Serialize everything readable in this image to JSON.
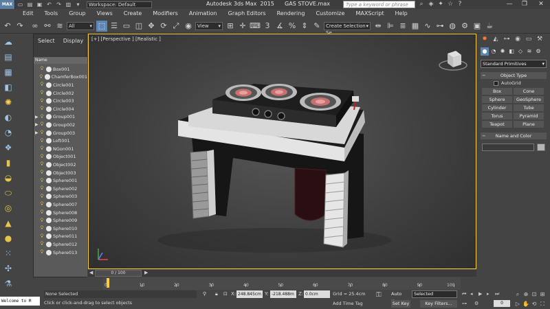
{
  "title_bar": {
    "logo": "MAX",
    "workspace": "Workspace: Default",
    "title": "Autodesk 3ds Max  2015      GAS STOVE.max",
    "search_placeholder": "Type a keyword or phrase"
  },
  "menu": [
    "Edit",
    "Tools",
    "Group",
    "Views",
    "Create",
    "Modifiers",
    "Animation",
    "Graph Editors",
    "Rendering",
    "Customize",
    "MAXScript",
    "Help"
  ],
  "toolbar": {
    "filter": "All",
    "ref_coord": "View",
    "named_sel": "Create Selection Se"
  },
  "explorer": {
    "tabs": [
      "Select",
      "Display"
    ],
    "header": "Name",
    "items": [
      {
        "name": "Box001",
        "group": false
      },
      {
        "name": "ChamferBox001",
        "group": false
      },
      {
        "name": "Circle001",
        "group": false
      },
      {
        "name": "Circle002",
        "group": false
      },
      {
        "name": "Circle003",
        "group": false
      },
      {
        "name": "Circle004",
        "group": false
      },
      {
        "name": "Group001",
        "group": true
      },
      {
        "name": "Group002",
        "group": true
      },
      {
        "name": "Group003",
        "group": true
      },
      {
        "name": "Loft001",
        "group": false
      },
      {
        "name": "NGon001",
        "group": false
      },
      {
        "name": "Object001",
        "group": false
      },
      {
        "name": "Object002",
        "group": false
      },
      {
        "name": "Object003",
        "group": false
      },
      {
        "name": "Sphere001",
        "group": false
      },
      {
        "name": "Sphere002",
        "group": false
      },
      {
        "name": "Sphere003",
        "group": false
      },
      {
        "name": "Sphere007",
        "group": false
      },
      {
        "name": "Sphere008",
        "group": false
      },
      {
        "name": "Sphere009",
        "group": false
      },
      {
        "name": "Sphere010",
        "group": false
      },
      {
        "name": "Sphere011",
        "group": false
      },
      {
        "name": "Sphere012",
        "group": false
      },
      {
        "name": "Sphere013",
        "group": false
      }
    ]
  },
  "viewport": {
    "label": "[+] [Perspective ] [Realistic ]"
  },
  "timeline": {
    "slider": "0 / 100",
    "ticks": [
      "0",
      "10",
      "20",
      "30",
      "40",
      "50",
      "60",
      "70",
      "80",
      "90",
      "100"
    ]
  },
  "status": {
    "listener": "Welcome to M",
    "selection": "None Selected",
    "prompt": "Click or click-and-drag to select objects",
    "x_label": "X:",
    "x": "248.845cm",
    "y_label": "Y:",
    "y": "-218.488m",
    "z_label": "Z:",
    "z": "0.0cm",
    "grid": "Grid = 25.4cm",
    "add_time_tag": "Add Time Tag",
    "auto_key": "Auto Key",
    "selected": "Selected",
    "set_key": "Set Key",
    "key_filters": "Key Filters...",
    "frame": "0"
  },
  "command_panel": {
    "type_dropdown": "Standard Primitives",
    "object_type_header": "Object Type",
    "autogrid": "AutoGrid",
    "primitives": [
      "Box",
      "Cone",
      "Sphere",
      "GeoSphere",
      "Cylinder",
      "Tube",
      "Torus",
      "Pyramid",
      "Teapot",
      "Plane"
    ],
    "name_color_header": "Name and Color"
  }
}
